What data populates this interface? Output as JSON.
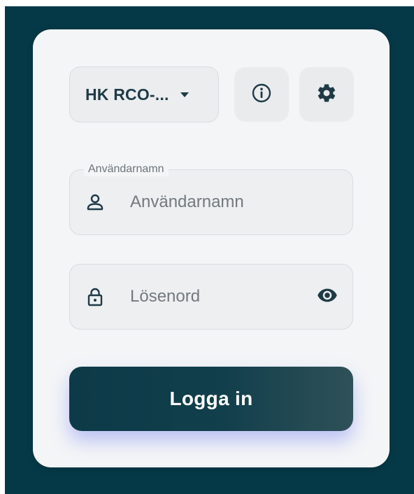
{
  "header": {
    "organization_select": {
      "selected_label": "HK RCO-...",
      "icon": "caret-down-icon"
    },
    "info_button": {
      "icon": "info-icon"
    },
    "settings_button": {
      "icon": "gear-icon"
    }
  },
  "form": {
    "username": {
      "legend": "Användarnamn",
      "placeholder": "Användarnamn",
      "value": "",
      "icon": "user-icon"
    },
    "password": {
      "placeholder": "Lösenord",
      "value": "",
      "icon": "lock-icon",
      "toggle_icon": "eye-icon"
    },
    "submit_label": "Logga in"
  },
  "colors": {
    "backdrop": "#063947",
    "card": "#f3f5f7",
    "primary_text": "#1f3a46",
    "button": "#0d3a48",
    "button_glow": "#7882f0"
  }
}
